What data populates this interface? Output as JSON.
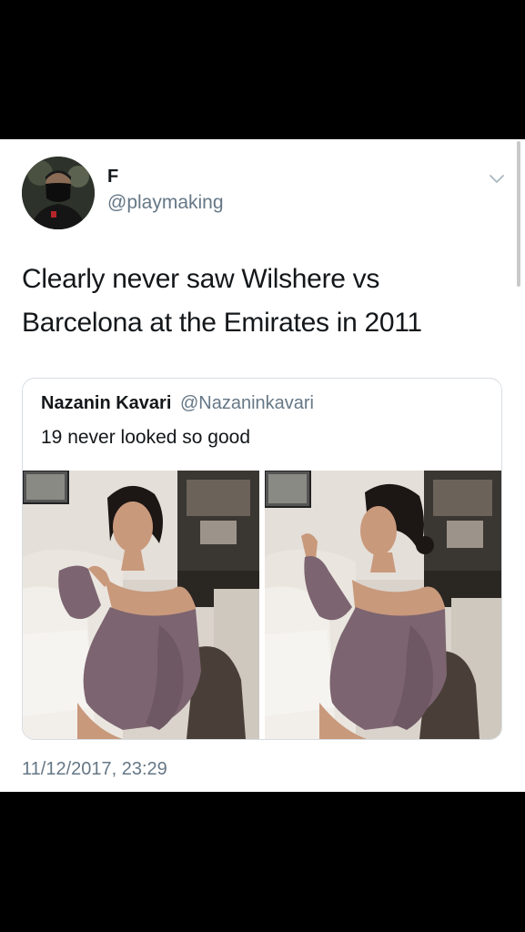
{
  "tweet": {
    "author": {
      "display_name": "F",
      "handle": "@playmaking",
      "avatar_icon": "avatar-masked-person"
    },
    "menu_icon": "chevron-down-icon",
    "text": "Clearly never saw Wilshere vs Barcelona at the Emirates in 2011",
    "timestamp": "11/12/2017, 23:29"
  },
  "quoted_tweet": {
    "author": {
      "display_name": "Nazanin Kavari",
      "handle": "@Nazaninkavari"
    },
    "text": "19 never looked so good",
    "photos": [
      "photo-woman-on-sofa-1",
      "photo-woman-on-sofa-2"
    ]
  },
  "colors": {
    "background_frame": "#000000",
    "card_background": "#ffffff",
    "primary_text": "#14171a",
    "secondary_text": "#657786",
    "card_border": "#d8dde2"
  }
}
